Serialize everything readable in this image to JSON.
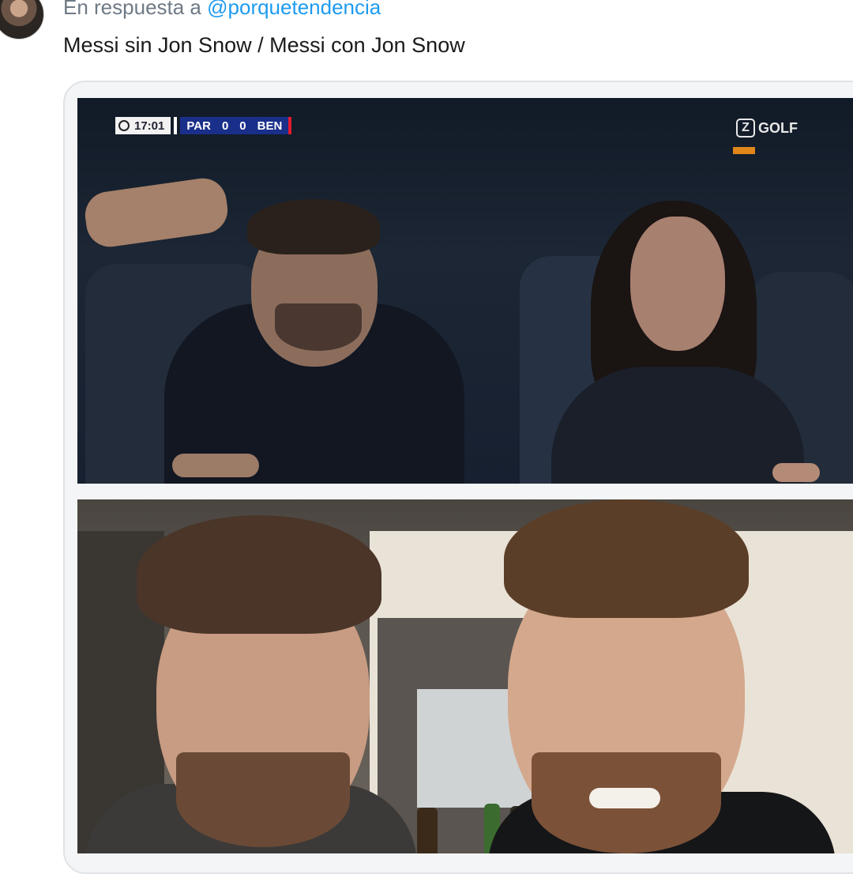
{
  "reply": {
    "prefix": "En respuesta a",
    "mention": "@porquetendencia"
  },
  "tweet": {
    "text": "Messi sin Jon Snow / Messi con Jon Snow"
  },
  "scoreboard": {
    "time": "17:01",
    "home_team": "PAR",
    "home_score": "0",
    "away_score": "0",
    "away_team": "BEN"
  },
  "channel": {
    "logo_letter": "Z",
    "name": "GOLF"
  },
  "icons": [
    "avatar",
    "football-icon",
    "channel-logo-icon"
  ],
  "colors": {
    "mention": "#1d9bf0",
    "secondary_text": "#6f7a85",
    "scorebug_blue": "#1a2f8a",
    "scorebug_red": "#e21b2c"
  }
}
